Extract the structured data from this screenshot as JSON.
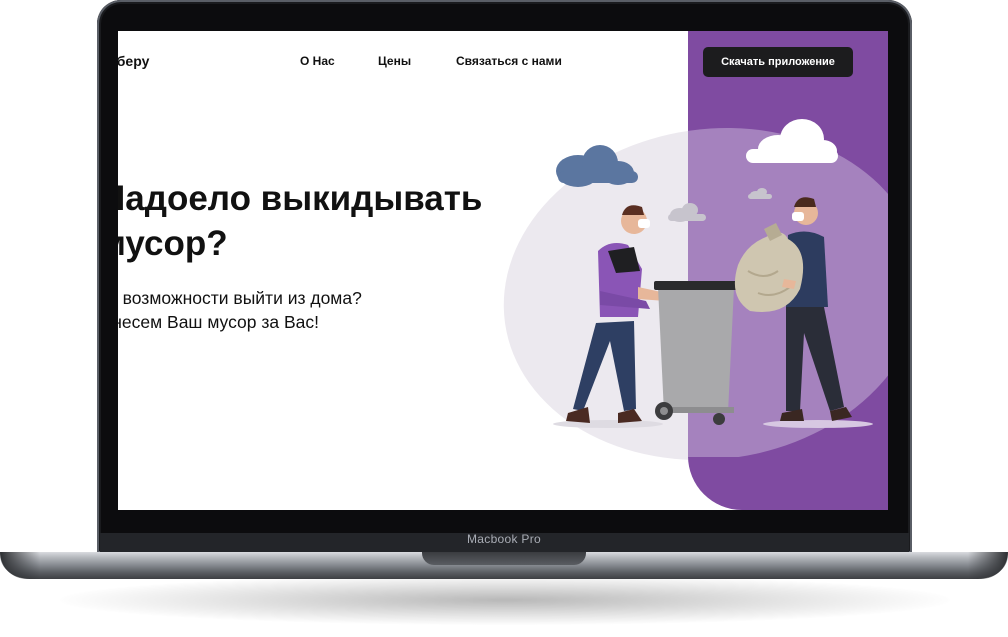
{
  "device": {
    "label": "Macbook Pro"
  },
  "site": {
    "logo": "аберу",
    "nav": [
      "О Нас",
      "Цены",
      "Связаться с нами"
    ],
    "cta": "Скачать приложение"
  },
  "hero": {
    "title_line1": "Надоело выкидывать",
    "title_line2": "мусор?",
    "subtitle_line1": "Нет возможности выйти из дома?",
    "subtitle_line2": "Вынесем Ваш мусор за Вас!"
  },
  "colors": {
    "accent_purple": "#7f4ba1",
    "button_dark": "#1c1c1e",
    "text": "#111111"
  },
  "icons": [
    "cloud-icon",
    "trash-bin-icon",
    "garbage-bag-icon"
  ]
}
